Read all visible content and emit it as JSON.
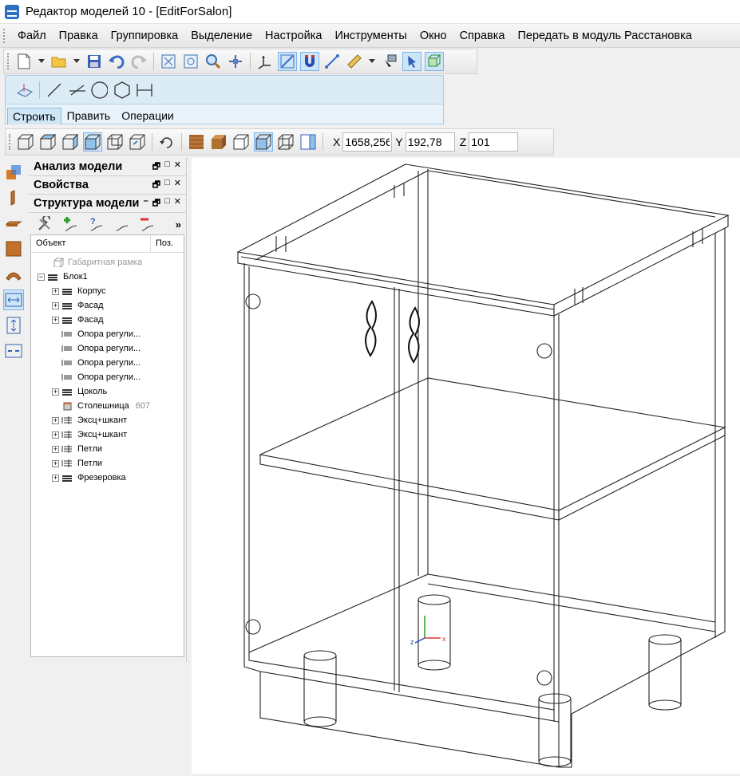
{
  "window": {
    "title": "Редактор моделей 10 - [EditForSalon]"
  },
  "menu": [
    "Файл",
    "Правка",
    "Группировка",
    "Выделение",
    "Настройка",
    "Инструменты",
    "Окно",
    "Справка",
    "Передать в модуль Расстановка"
  ],
  "build_panel": {
    "tabs": [
      "Строить",
      "Править",
      "Операции"
    ],
    "active_tab": "Строить"
  },
  "coords": {
    "x_label": "X",
    "x_value": "1658,256",
    "y_label": "Y",
    "y_value": "192,78",
    "z_label": "Z",
    "z_value": "101"
  },
  "panels": {
    "analysis": "Анализ модели",
    "properties": "Свойства",
    "structure": "Структура модели",
    "more": "»"
  },
  "tree": {
    "col_object": "Объект",
    "col_pos": "Поз.",
    "items": [
      {
        "label": "Габаритная рамка",
        "pos": ""
      },
      {
        "label": "Блок1",
        "pos": ""
      },
      {
        "label": "Корпус",
        "pos": ""
      },
      {
        "label": "Фасад",
        "pos": ""
      },
      {
        "label": "Фасад",
        "pos": ""
      },
      {
        "label": "Опора регули...",
        "pos": ""
      },
      {
        "label": "Опора регули...",
        "pos": ""
      },
      {
        "label": "Опора регули...",
        "pos": ""
      },
      {
        "label": "Опора регули...",
        "pos": ""
      },
      {
        "label": "Цоколь",
        "pos": ""
      },
      {
        "label": "Столешница",
        "pos": "607"
      },
      {
        "label": "Эксц+шкант",
        "pos": ""
      },
      {
        "label": "Эксц+шкант",
        "pos": ""
      },
      {
        "label": "Петли",
        "pos": ""
      },
      {
        "label": "Петли",
        "pos": ""
      },
      {
        "label": "Фрезеровка",
        "pos": ""
      }
    ]
  }
}
